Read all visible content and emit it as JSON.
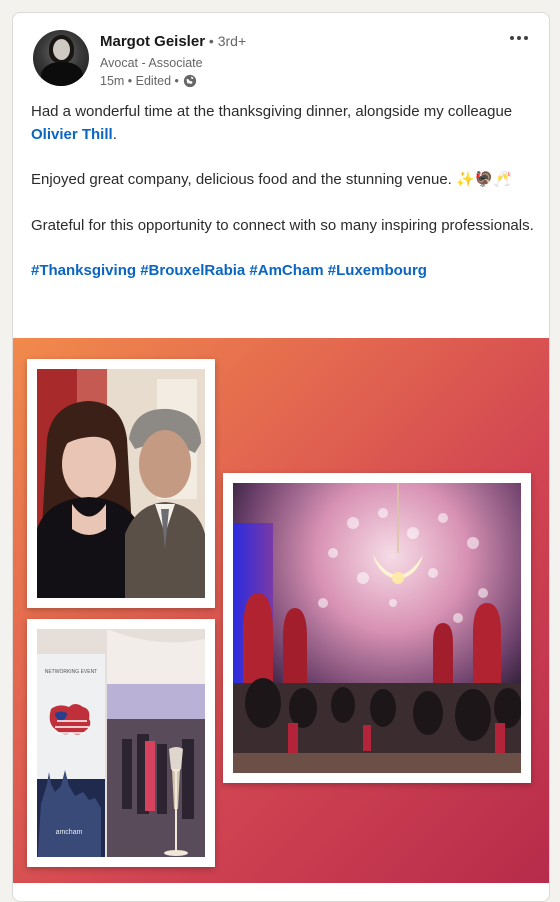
{
  "post": {
    "author_name": "Margot Geisler",
    "degree": " • 3rd+",
    "author_title": "Avocat - Associate",
    "time_meta": "15m • Edited •",
    "text_line1_prefix": "Had a wonderful time at the  thanksgiving dinner, alongside my colleague ",
    "mention": "Olivier Thill",
    "text_line1_suffix": ".",
    "text_para2": "Enjoyed great company, delicious food and the stunning venue. ✨🦃🥂",
    "text_para3": "Grateful for this opportunity to connect with so many inspiring professionals.",
    "hashtags": [
      "#Thanksgiving",
      "#BrouxelRabia",
      "#AmCham",
      "#Luxembourg"
    ]
  },
  "media": {
    "photo3_banner_text": "amcham",
    "photo3_banner_header": "NETWORKING EVENT"
  },
  "icons": {
    "more": "more-horizontal-icon",
    "visibility": "globe-icon"
  },
  "colors": {
    "link": "#0a66c2",
    "background": "#f4f2ee"
  }
}
